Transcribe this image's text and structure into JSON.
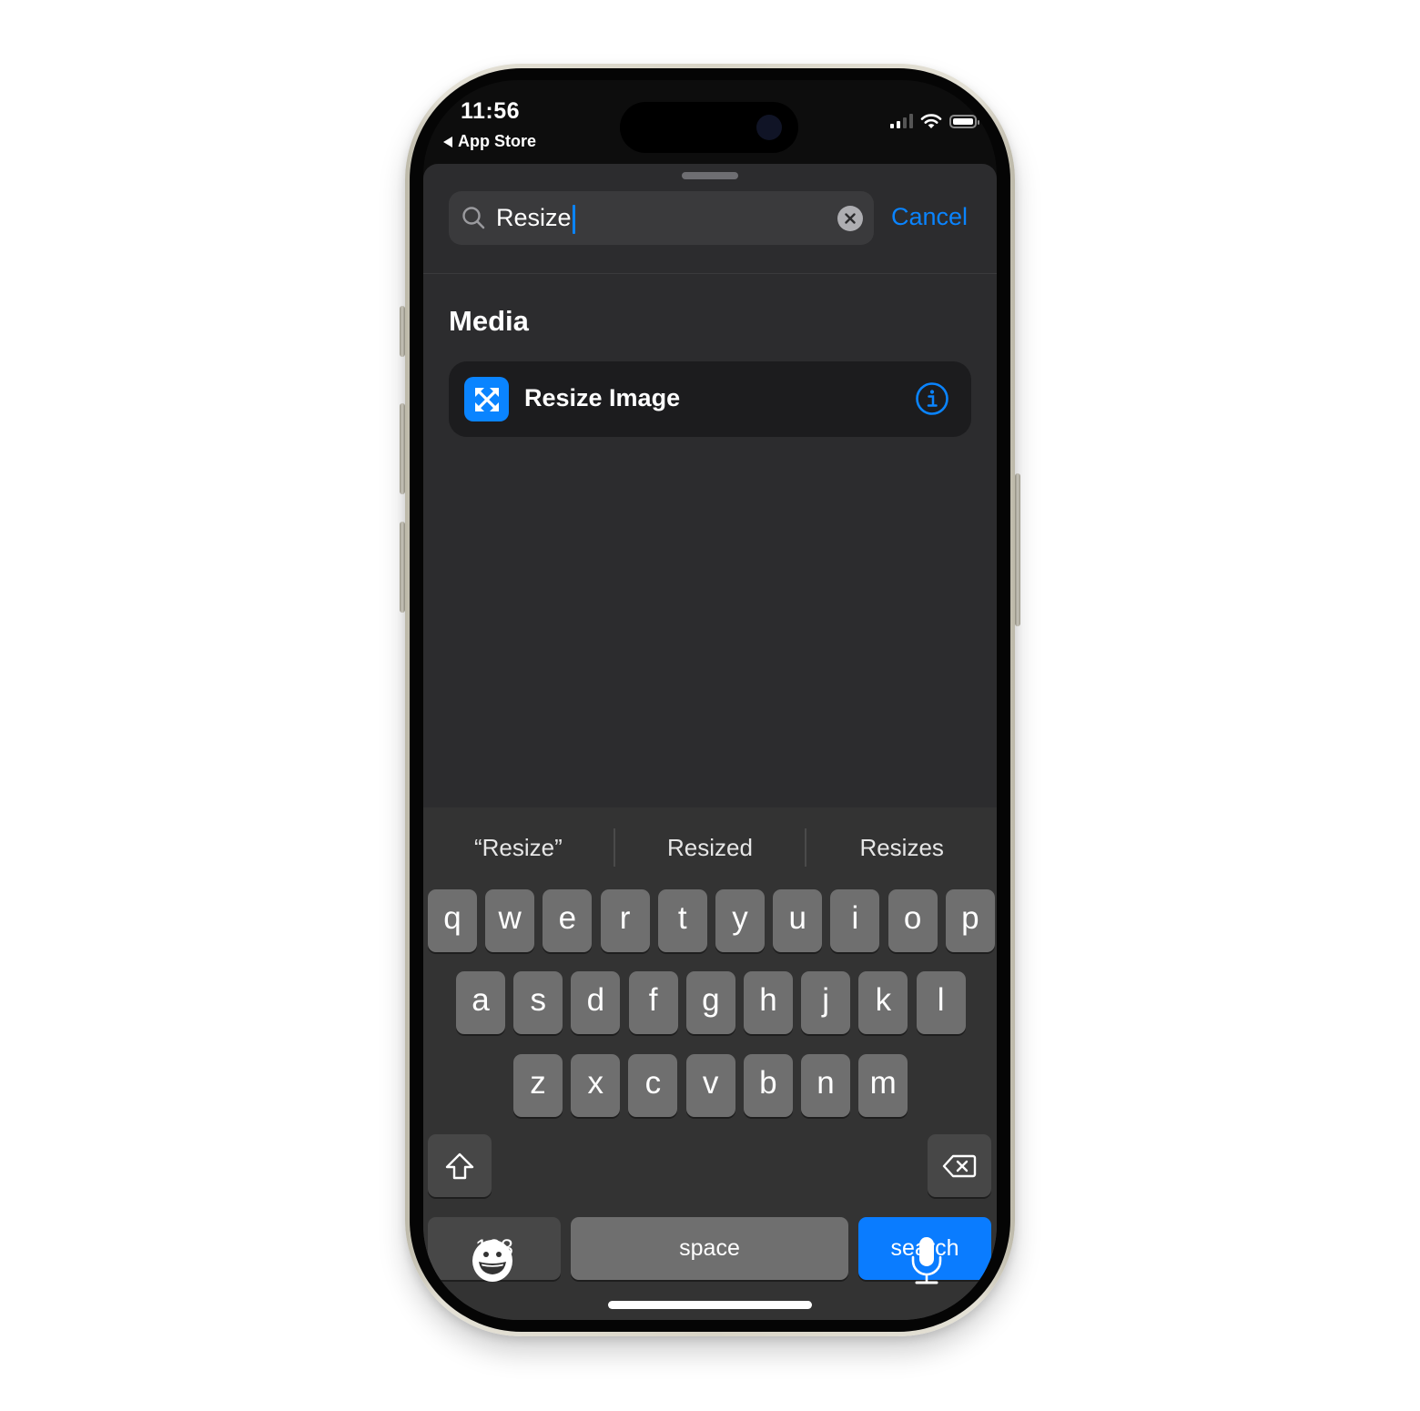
{
  "status_bar": {
    "time": "11:56",
    "back_label": "App Store",
    "icons": [
      "cellular-signal-icon",
      "wifi-icon",
      "battery-icon"
    ]
  },
  "search": {
    "value": "Resize",
    "clear_icon": "clear-circle-icon",
    "cancel_label": "Cancel"
  },
  "results": {
    "section_title": "Media",
    "items": [
      {
        "label": "Resize Image",
        "icon": "arrows-expand-icon",
        "icon_color": "#0a84ff",
        "info_icon": "info-circle-icon"
      }
    ]
  },
  "keyboard": {
    "suggestions": [
      "“Resize”",
      "Resized",
      "Resizes"
    ],
    "rows": [
      [
        "q",
        "w",
        "e",
        "r",
        "t",
        "y",
        "u",
        "i",
        "o",
        "p"
      ],
      [
        "a",
        "s",
        "d",
        "f",
        "g",
        "h",
        "j",
        "k",
        "l"
      ],
      [
        "z",
        "x",
        "c",
        "v",
        "b",
        "n",
        "m"
      ]
    ],
    "numbers_label": "123",
    "space_label": "space",
    "search_label": "search",
    "emoji_icon": "emoji-icon",
    "mic_icon": "microphone-icon"
  },
  "colors": {
    "accent": "#0a84ff",
    "sheet_bg": "#2c2c2e",
    "keyboard_bg": "#333333",
    "key_bg": "#6f6f6f"
  }
}
